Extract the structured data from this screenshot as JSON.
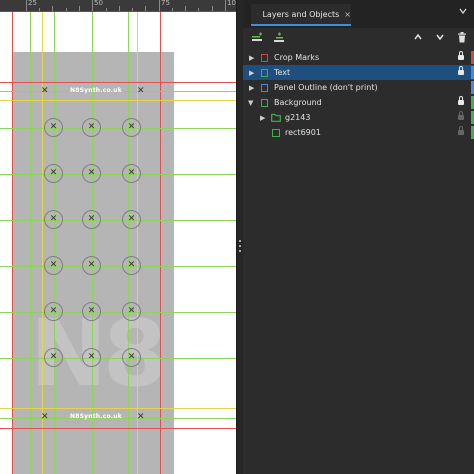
{
  "ruler": {
    "labels": [
      "25",
      "50",
      "75",
      "10"
    ]
  },
  "canvas": {
    "brand_text": "N8Synth.co.uk",
    "logo_text": "N8",
    "colors": {
      "panel": "#b5b5b5",
      "guide_red": "#e05050",
      "guide_green": "#8fd45a",
      "guide_yellow": "#e6d44a"
    }
  },
  "dock": {
    "tab": {
      "icon": "layers-icon",
      "title": "Layers and Objects",
      "close": "×"
    },
    "menu_icon": "chevron-down-icon",
    "toolbar": {
      "add_layer_icon": "add-layer-icon",
      "add_sublayer_icon": "add-sublayer-icon",
      "raise_icon": "chevron-up-icon",
      "lower_icon": "chevron-down-icon",
      "delete_icon": "trash-icon"
    },
    "layers": [
      {
        "label": "Crop Marks",
        "color": "#e04040",
        "expanded": false,
        "selected": false,
        "locked": true
      },
      {
        "label": "Text",
        "color": "#3fb24a",
        "expanded": false,
        "selected": true,
        "locked": true
      },
      {
        "label": "Panel Outline (don't print)",
        "color": "#3d8de0",
        "expanded": false,
        "selected": false,
        "locked": false
      },
      {
        "label": "Background",
        "color": "#3fb24a",
        "expanded": true,
        "selected": false,
        "locked": true
      },
      {
        "label": "g2143",
        "color": "#3fb24a",
        "kind": "group",
        "expanded": false,
        "selected": false,
        "locked": false
      },
      {
        "label": "rect6901",
        "color": "#3fb24a",
        "kind": "object",
        "selected": false,
        "locked": false
      }
    ]
  }
}
